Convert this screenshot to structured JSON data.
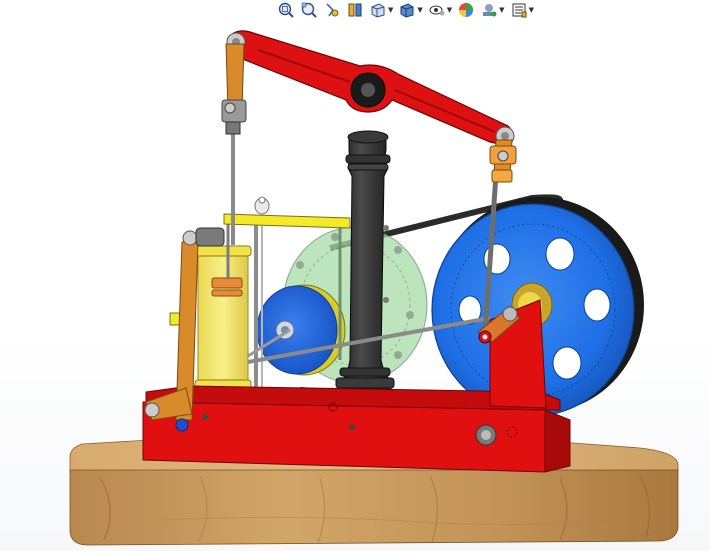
{
  "viewport": {
    "background": "#ffffff",
    "model": "beam-engine-assembly"
  },
  "hud_toolbar": {
    "buttons": [
      {
        "icon": "zoom-to-fit-icon",
        "dropdown": false
      },
      {
        "icon": "zoom-to-area-icon",
        "dropdown": false
      },
      {
        "icon": "previous-view-icon",
        "dropdown": false
      },
      {
        "icon": "section-view-icon",
        "dropdown": false
      },
      {
        "icon": "view-orientation-icon",
        "dropdown": true
      },
      {
        "icon": "display-style-icon",
        "dropdown": true
      },
      {
        "icon": "hide-show-items-icon",
        "dropdown": true
      },
      {
        "icon": "edit-appearance-icon",
        "dropdown": false
      },
      {
        "icon": "apply-scene-icon",
        "dropdown": true
      },
      {
        "icon": "view-settings-icon",
        "dropdown": true
      }
    ]
  },
  "colors": {
    "frame_red": "#e01010",
    "beam_red": "#dd1111",
    "flywheel_blue": "#1e6fe6",
    "column_black": "#2a2a2a",
    "link_orange": "#d98a2a",
    "cylinder_yellow": "#f2e24a",
    "pushrod_yellow": "#f4ea2a",
    "wood_base": "#c89a5c",
    "translucent_green": "#9fd9a0"
  }
}
